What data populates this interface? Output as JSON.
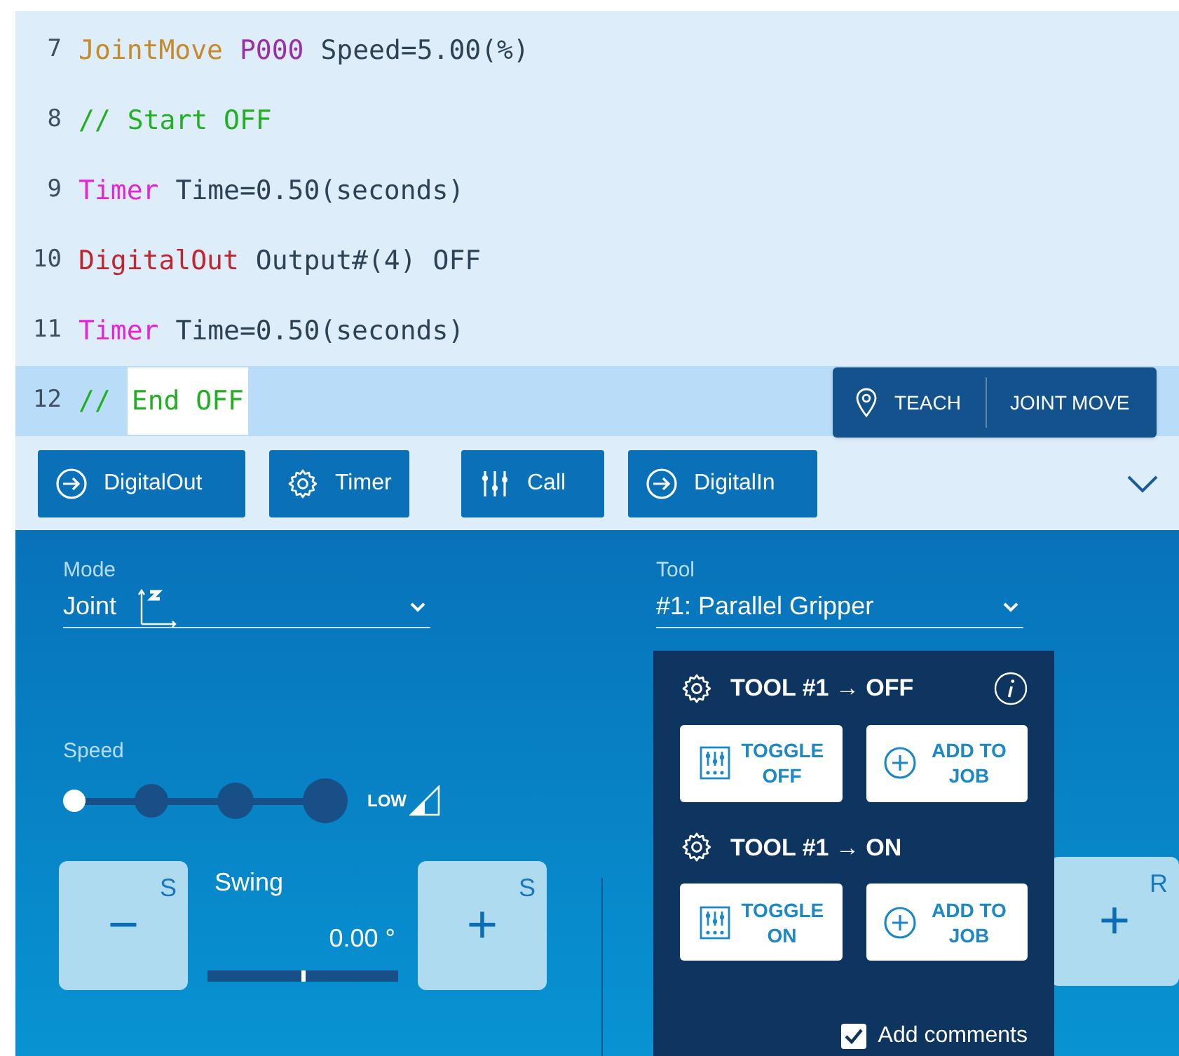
{
  "code_lines": [
    {
      "number": "7",
      "selected": false,
      "tokens": [
        {
          "kind": "move",
          "text": "JointMove",
          "highlighted": false
        },
        {
          "kind": "point",
          "text": "P000",
          "highlighted": false
        },
        {
          "kind": "plain",
          "text": "Speed=5.00(%)",
          "highlighted": false
        }
      ]
    },
    {
      "number": "8",
      "selected": false,
      "tokens": [
        {
          "kind": "comment",
          "text": "//",
          "highlighted": false
        },
        {
          "kind": "comment",
          "text": "Start OFF",
          "highlighted": false
        }
      ]
    },
    {
      "number": "9",
      "selected": false,
      "tokens": [
        {
          "kind": "timer",
          "text": "Timer",
          "highlighted": false
        },
        {
          "kind": "plain",
          "text": "Time=0.50(seconds)",
          "highlighted": false
        }
      ]
    },
    {
      "number": "10",
      "selected": false,
      "tokens": [
        {
          "kind": "output",
          "text": "DigitalOut",
          "highlighted": false
        },
        {
          "kind": "plain",
          "text": "Output#(4)",
          "highlighted": false
        },
        {
          "kind": "plain",
          "text": "OFF",
          "highlighted": false
        }
      ]
    },
    {
      "number": "11",
      "selected": false,
      "tokens": [
        {
          "kind": "timer",
          "text": "Timer",
          "highlighted": false
        },
        {
          "kind": "plain",
          "text": "Time=0.50(seconds)",
          "highlighted": false
        }
      ]
    },
    {
      "number": "12",
      "selected": true,
      "tokens": [
        {
          "kind": "comment",
          "text": "//",
          "highlighted": false
        },
        {
          "kind": "comment",
          "text": "End OFF",
          "highlighted": true
        }
      ]
    }
  ],
  "teach_popup": {
    "teach": "TEACH",
    "joint_move": "JOINT MOVE"
  },
  "toolbar": [
    {
      "kind": "in-out",
      "label": "DigitalOut"
    },
    {
      "kind": "gear",
      "label": "Timer"
    },
    {
      "kind": "sliders",
      "label": "Call"
    },
    {
      "kind": "in-out",
      "label": "DigitalIn"
    }
  ],
  "mode": {
    "label": "Mode",
    "value": "Joint"
  },
  "tool": {
    "label": "Tool",
    "value": "#1: Parallel Gripper"
  },
  "speed": {
    "label": "Speed",
    "steps": [
      {
        "selected": true
      },
      {
        "selected": false
      },
      {
        "selected": false
      },
      {
        "selected": false
      }
    ],
    "indicator": "LOW"
  },
  "swing": {
    "minus": {
      "symbol": "−",
      "axis": "S"
    },
    "label": "Swing",
    "value": "0.00 °",
    "level": 0.5,
    "plus": {
      "symbol": "+",
      "axis": "S"
    }
  },
  "right_button": {
    "symbol": "+",
    "axis": "R"
  },
  "tool_popup": {
    "sections": [
      {
        "title": "TOOL #1 → OFF",
        "info": true,
        "buttons": [
          {
            "kind": "toggle",
            "label": "TOGGLE OFF"
          },
          {
            "kind": "add",
            "label": "ADD TO JOB"
          }
        ]
      },
      {
        "title": "TOOL #1 → ON",
        "info": false,
        "buttons": [
          {
            "kind": "toggle",
            "label": "TOGGLE ON"
          },
          {
            "kind": "add",
            "label": "ADD TO JOB"
          }
        ]
      }
    ],
    "add_comments": {
      "label": "Add comments",
      "checked": true
    }
  }
}
